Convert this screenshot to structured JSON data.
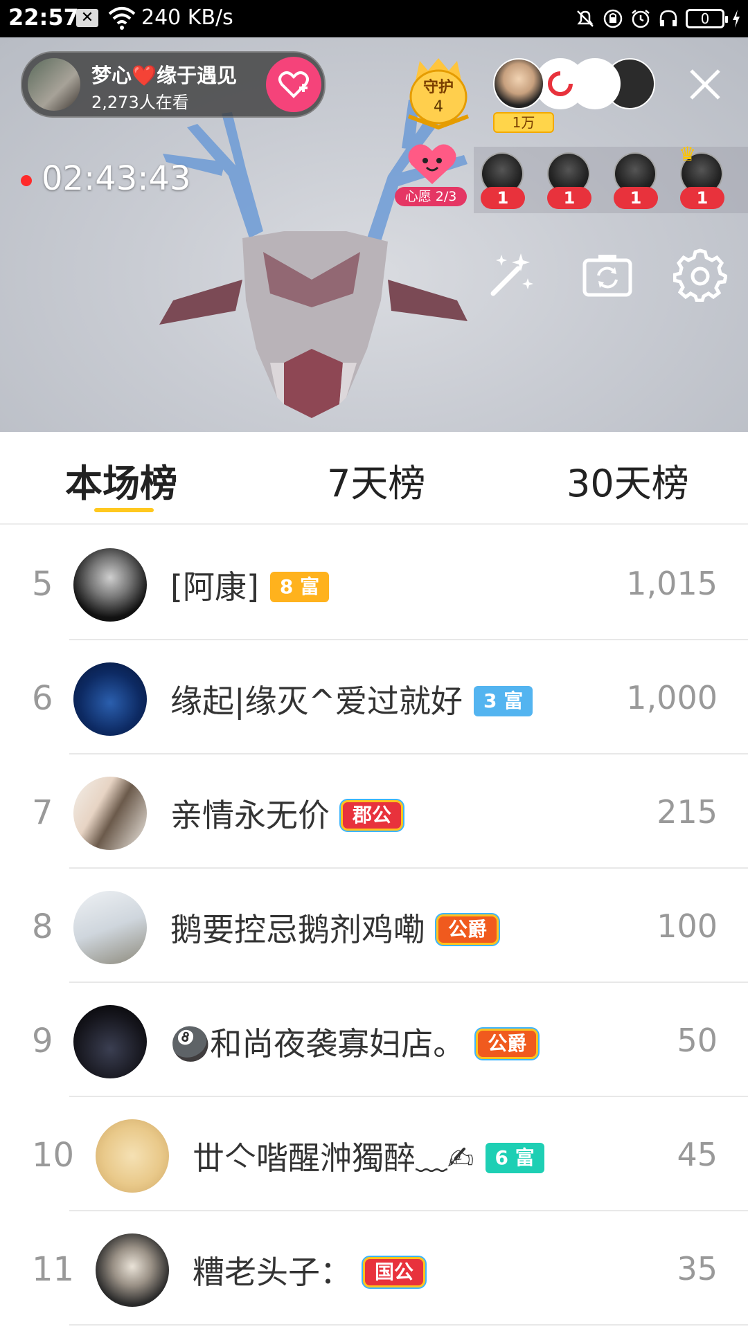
{
  "status_bar": {
    "time": "22:57",
    "net_speed": "240 KB/s",
    "battery": "0"
  },
  "live": {
    "host_name": "梦心❤️缘于遇见",
    "viewers": "2,273人在看",
    "guard_label": "守护",
    "guard_count": "4",
    "top_contrib": "1万",
    "timer": "02:43:43",
    "wish_label": "心愿 2/3",
    "fan_counts": [
      "1",
      "1",
      "1",
      "1"
    ]
  },
  "tabs": [
    {
      "label": "本场榜",
      "active": true
    },
    {
      "label": "7天榜",
      "active": false
    },
    {
      "label": "30天榜",
      "active": false
    }
  ],
  "ranking": [
    {
      "rank": "5",
      "name": "[阿康]",
      "badge": "8 富",
      "badge_style": "orange",
      "score": "1,015"
    },
    {
      "rank": "6",
      "name": "缘起|缘灭^爱过就好",
      "badge": "3 富",
      "badge_style": "blue",
      "score": "1,000"
    },
    {
      "rank": "7",
      "name": "亲情永无价",
      "badge": "郡公",
      "badge_style": "red",
      "score": "215"
    },
    {
      "rank": "8",
      "name": "鹅要控忌鹅剂鸡嘞",
      "badge": "公爵",
      "badge_style": "orangered",
      "score": "100"
    },
    {
      "rank": "9",
      "name": "🎱和尚夜袭寡妇店。",
      "badge": "公爵",
      "badge_style": "orangered",
      "score": "50"
    },
    {
      "rank": "10",
      "name": "丗亽喈醒浺獨醉﹏✍",
      "badge": "6 富",
      "badge_style": "teal",
      "score": "45"
    },
    {
      "rank": "11",
      "name": "糟老头子：",
      "badge": "国公",
      "badge_style": "red",
      "score": "35"
    }
  ]
}
